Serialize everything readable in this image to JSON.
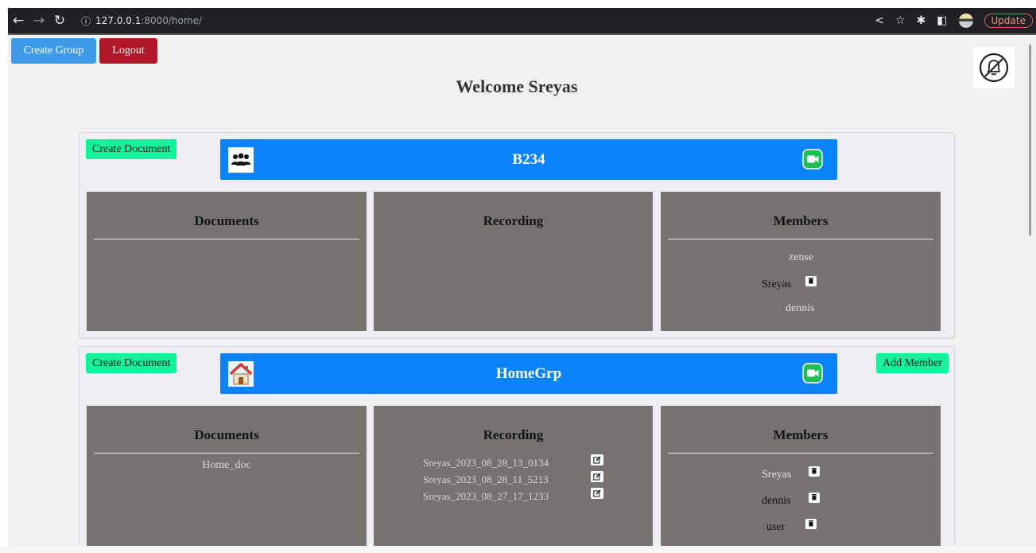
{
  "browser": {
    "url_host": "127.0.0.1",
    "url_rest": ":8000/home/",
    "update_label": "Update"
  },
  "top_buttons": {
    "create_group": "Create Group",
    "logout": "Logout"
  },
  "welcome": "Welcome Sreyas",
  "groups": [
    {
      "name": "B234",
      "create_document": "Create Document",
      "documents_title": "Documents",
      "recording_title": "Recording",
      "members_title": "Members",
      "members": [
        "zense",
        "Sreyas",
        "dennis"
      ]
    },
    {
      "name": "HomeGrp",
      "create_document": "Create Document",
      "add_member": "Add Member",
      "documents_title": "Documents",
      "recording_title": "Recording",
      "members_title": "Members",
      "documents": [
        "Home_doc"
      ],
      "recordings": [
        "Sreyas_2023_08_28_13_0134",
        "Sreyas_2023_08_28_11_5213",
        "Sreyas_2023_08_27_17_1233"
      ],
      "members": [
        "Sreyas",
        "dennis",
        "user"
      ]
    }
  ],
  "colors": {
    "header_blue": "#0a82fa",
    "green_button": "#17f09a",
    "panel_gray": "#767270",
    "logout_red": "#b0182a",
    "create_group_blue": "#3d9be9"
  }
}
